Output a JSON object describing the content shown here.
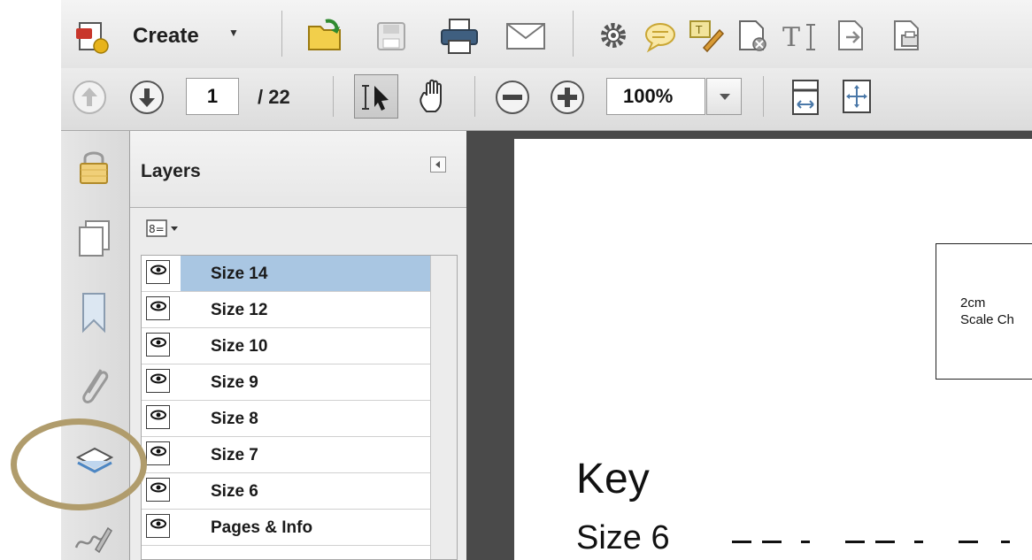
{
  "toolbar": {
    "create_label": "Create",
    "icons": [
      "create-icon",
      "open-folder-icon",
      "save-icon",
      "print-icon",
      "email-icon",
      "gear-icon",
      "comment-icon",
      "sign-icon",
      "document-tool-icon",
      "text-tool-icon",
      "export-icon",
      "print-production-icon"
    ]
  },
  "navigation": {
    "page_current": "1",
    "page_total": "/ 22",
    "zoom": "100%"
  },
  "layers_panel": {
    "title": "Layers",
    "items": [
      {
        "label": "Size 14",
        "selected": true
      },
      {
        "label": "Size 12",
        "selected": false
      },
      {
        "label": "Size 10",
        "selected": false
      },
      {
        "label": "Size 9",
        "selected": false
      },
      {
        "label": "Size 8",
        "selected": false
      },
      {
        "label": "Size 7",
        "selected": false
      },
      {
        "label": "Size 6",
        "selected": false
      },
      {
        "label": "Pages & Info",
        "selected": false
      }
    ]
  },
  "document": {
    "scale_text": "2cm\nScale Ch",
    "key_title": "Key",
    "key_size": "Size 6"
  },
  "colors": {
    "selection": "#a9c6e2",
    "highlight_ring": "#b09c6c",
    "doc_background": "#4a4a4a"
  }
}
